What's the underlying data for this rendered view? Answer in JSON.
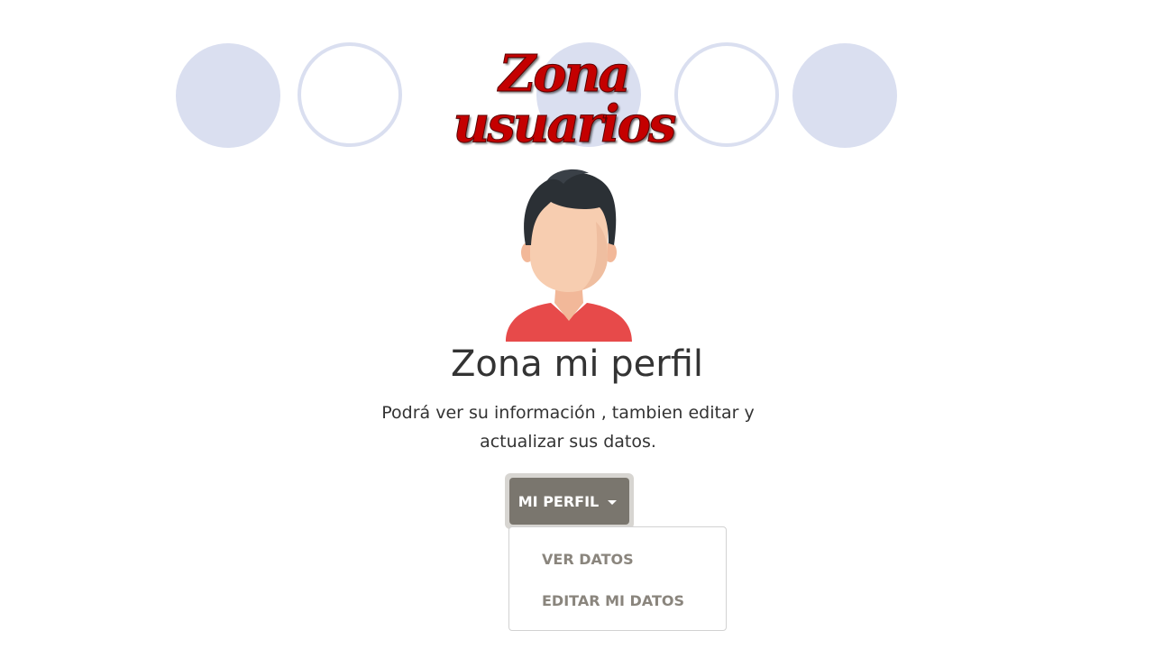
{
  "banner": {
    "title": "Zona usuarios"
  },
  "profile": {
    "title": "Zona mi perfil",
    "description": "Podrá ver su información , tambien editar y actualizar sus datos."
  },
  "menu": {
    "button_label": "MI PERFIL",
    "items": [
      {
        "label": "VER DATOS"
      },
      {
        "label": "EDITAR MI DATOS"
      }
    ]
  },
  "colors": {
    "banner_circle": "#dadff0",
    "banner_title": "#c40000",
    "button_bg": "#7a766e",
    "menu_item_text": "#8a857d",
    "shirt": "#e74a4a",
    "hair": "#2b3035",
    "skin": "#f7cdb0"
  },
  "icons": {
    "avatar": "user-avatar-icon",
    "caret": "caret-down-icon"
  }
}
